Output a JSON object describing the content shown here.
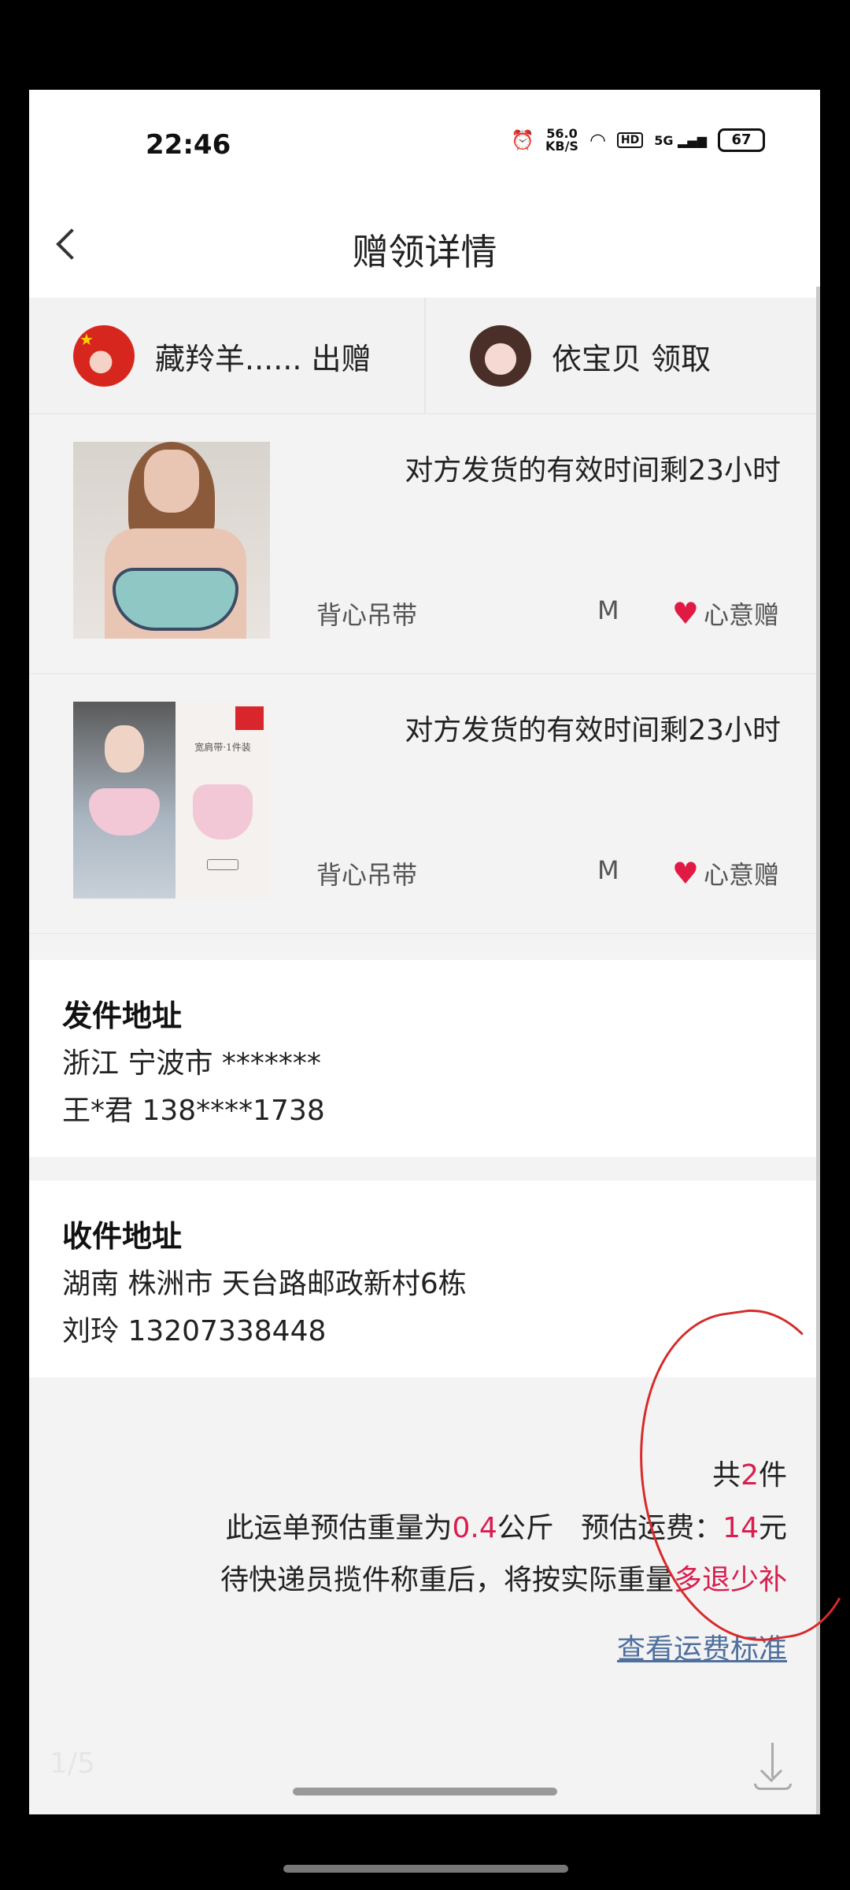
{
  "status_bar": {
    "time": "22:46",
    "net_speed_value": "56.0",
    "net_speed_unit": "KB/S",
    "hd": "HD",
    "signal": "5G",
    "battery": "67"
  },
  "header": {
    "title": "赠领详情"
  },
  "parties": {
    "giver": "藏羚羊...... 出赠",
    "receiver": "依宝贝 领取"
  },
  "items": [
    {
      "deadline": "对方发货的有效时间剩23小时",
      "name": "背心吊带",
      "size": "M",
      "gift_label": "心意赠"
    },
    {
      "deadline": "对方发货的有效时间剩23小时",
      "name": "背心吊带",
      "size": "M",
      "gift_label": "心意赠",
      "image_text": "宽肩带·1件装"
    }
  ],
  "sender_address": {
    "title": "发件地址",
    "line1": "浙江 宁波市 *******",
    "line2": "王*君 138****1738"
  },
  "receiver_address": {
    "title": "收件地址",
    "line1": "湖南 株洲市 天台路邮政新村6栋",
    "line2": "刘玲 13207338448"
  },
  "summary": {
    "count_prefix": "共",
    "count": "2",
    "count_suffix": "件",
    "weight_prefix": "此运单预估重量为",
    "weight": "0.4",
    "weight_unit": "公斤",
    "fee_label": "预估运费：",
    "fee": "14",
    "fee_unit": "元",
    "note_prefix": "待快递员揽件称重后，将按实际重量",
    "note_highlight": "多退少补",
    "link": "查看运费标准"
  },
  "viewer": {
    "page_indicator": "1/5"
  },
  "colors": {
    "accent": "#d81e4e",
    "link": "#4f6f9d",
    "heart": "#e11a44"
  }
}
